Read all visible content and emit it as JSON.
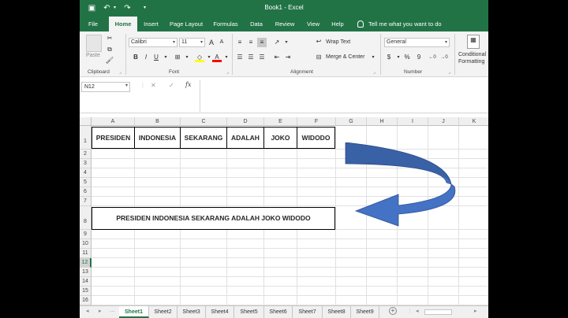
{
  "titlebar": {
    "title": "Book1  -  Excel"
  },
  "tabs": [
    "File",
    "Home",
    "Insert",
    "Page Layout",
    "Formulas",
    "Data",
    "Review",
    "View",
    "Help"
  ],
  "tell_me": "Tell me what you want to do",
  "ribbon": {
    "clipboard": {
      "paste": "Paste",
      "label": "Clipboard"
    },
    "font": {
      "name": "Calibri",
      "size": "11",
      "bold": "B",
      "italic": "I",
      "underline": "U",
      "label": "Font"
    },
    "alignment": {
      "wrap_text": "Wrap Text",
      "merge_center": "Merge & Center",
      "label": "Alignment"
    },
    "number": {
      "format": "General",
      "percent": "%",
      "comma": "9",
      "label": "Number"
    },
    "styles": {
      "conditional": "Conditional",
      "formatting": "Formatting"
    }
  },
  "formula_bar": {
    "name_box": "N12",
    "fx": "fx",
    "cancel": "✕",
    "enter": "✓",
    "formula": ""
  },
  "columns": [
    "A",
    "B",
    "C",
    "D",
    "E",
    "F",
    "G",
    "H",
    "I",
    "J",
    "K"
  ],
  "rows": [
    "1",
    "2",
    "3",
    "4",
    "5",
    "6",
    "7",
    "8",
    "9",
    "10",
    "11",
    "12",
    "13",
    "14",
    "15",
    "16"
  ],
  "selected_row": "12",
  "row1_cells": [
    "PRESIDEN",
    "INDONESIA",
    "SEKARANG",
    "ADALAH",
    "JOKO",
    "WIDODO"
  ],
  "row8_merged": "PRESIDEN INDONESIA SEKARANG ADALAH JOKO WIDODO",
  "arrow_color": "#4472c4",
  "sheets": [
    "Sheet1",
    "Sheet2",
    "Sheet3",
    "Sheet4",
    "Sheet5",
    "Sheet6",
    "Sheet7",
    "Sheet8",
    "Sheet9"
  ],
  "active_sheet": "Sheet1",
  "add_sheet": "+"
}
